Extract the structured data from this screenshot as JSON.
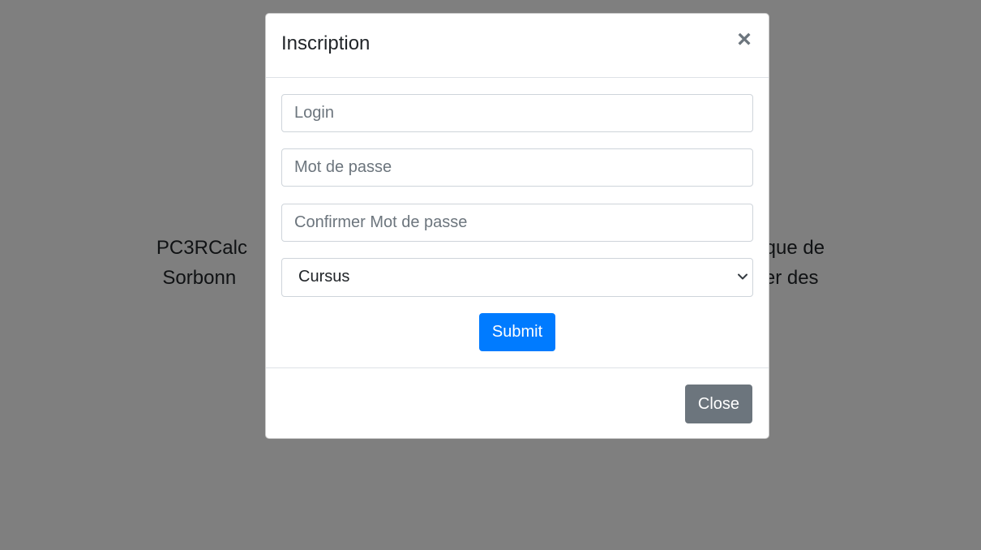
{
  "background": {
    "line1": "PC3RCalc",
    "line1_right": "natique de",
    "line2": "Sorbonn",
    "line2_right": "niser des"
  },
  "modal": {
    "title": "Inscription",
    "close_icon": "×",
    "form": {
      "login_placeholder": "Login",
      "password_placeholder": "Mot de passe",
      "confirm_placeholder": "Confirmer Mot de passe",
      "cursus_selected": "Cursus",
      "submit_label": "Submit"
    },
    "footer": {
      "close_label": "Close"
    }
  },
  "colors": {
    "primary": "#007bff",
    "secondary": "#6c757d",
    "backdrop": "rgba(0,0,0,0.5)"
  }
}
